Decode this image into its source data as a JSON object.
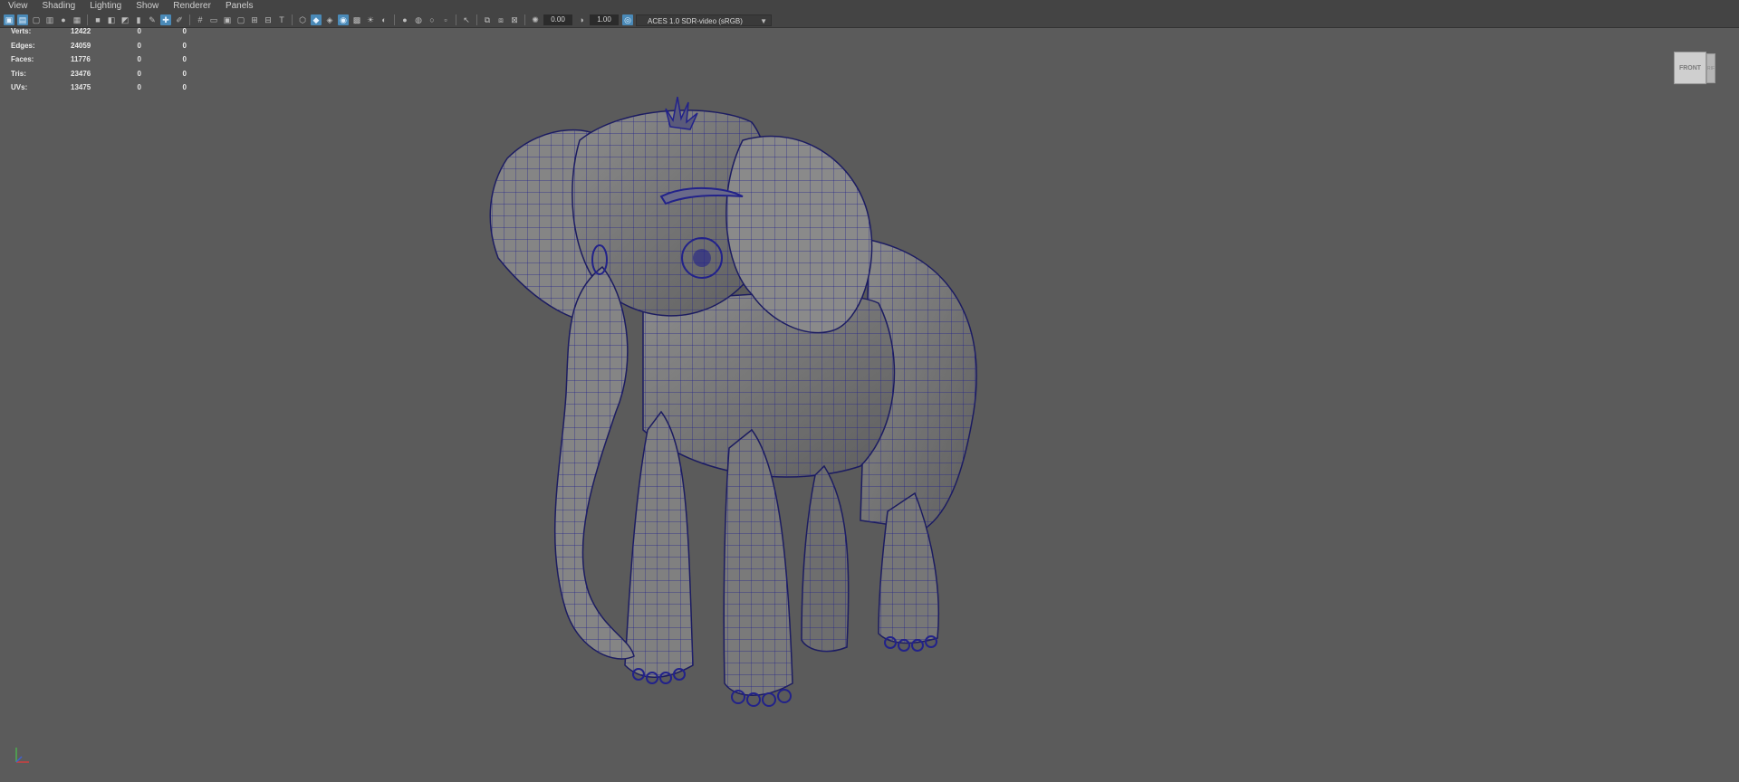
{
  "menu": [
    "View",
    "Shading",
    "Lighting",
    "Show",
    "Renderer",
    "Panels"
  ],
  "toolbar": {
    "exposure_value": "0.00",
    "gamma_value": "1.00",
    "color_space": "ACES 1.0 SDR-video (sRGB)",
    "icons": [
      "select-camera-icon",
      "camera-attributes-icon",
      "bookmark-icon",
      "image-plane-icon",
      "grid-icon",
      "film-gate-icon",
      "resolution-gate-icon",
      "gate-mask-icon",
      "field-chart-icon",
      "safe-action-icon",
      "safe-title-icon",
      "wireframe-icon",
      "smooth-shade-icon",
      "wireframe-on-shaded-icon",
      "textured-icon",
      "lights-icon",
      "shadows-icon",
      "screen-space-ao-icon",
      "motion-blur-icon",
      "anti-aliasing-icon",
      "depth-of-field-icon",
      "isolate-select-icon",
      "xray-icon",
      "xray-joints-icon",
      "backface-culling-icon",
      "exposure-icon",
      "gamma-icon",
      "color-management-icon"
    ],
    "accent_color": "#4a8ab8"
  },
  "hud": {
    "rows": [
      {
        "label": "Verts:",
        "v1": "12422",
        "v2": "0",
        "v3": "0"
      },
      {
        "label": "Edges:",
        "v1": "24059",
        "v2": "0",
        "v3": "0"
      },
      {
        "label": "Faces:",
        "v1": "11776",
        "v2": "0",
        "v3": "0"
      },
      {
        "label": "Tris:",
        "v1": "23476",
        "v2": "0",
        "v3": "0"
      },
      {
        "label": "UVs:",
        "v1": "13475",
        "v2": "0",
        "v3": "0"
      }
    ]
  },
  "viewcube": {
    "front_label": "FRONT",
    "side_label": "RIF"
  },
  "viewport": {
    "background_color": "#5b5b5b",
    "wire_color": "#22228a",
    "model": "elephant-mesh"
  }
}
